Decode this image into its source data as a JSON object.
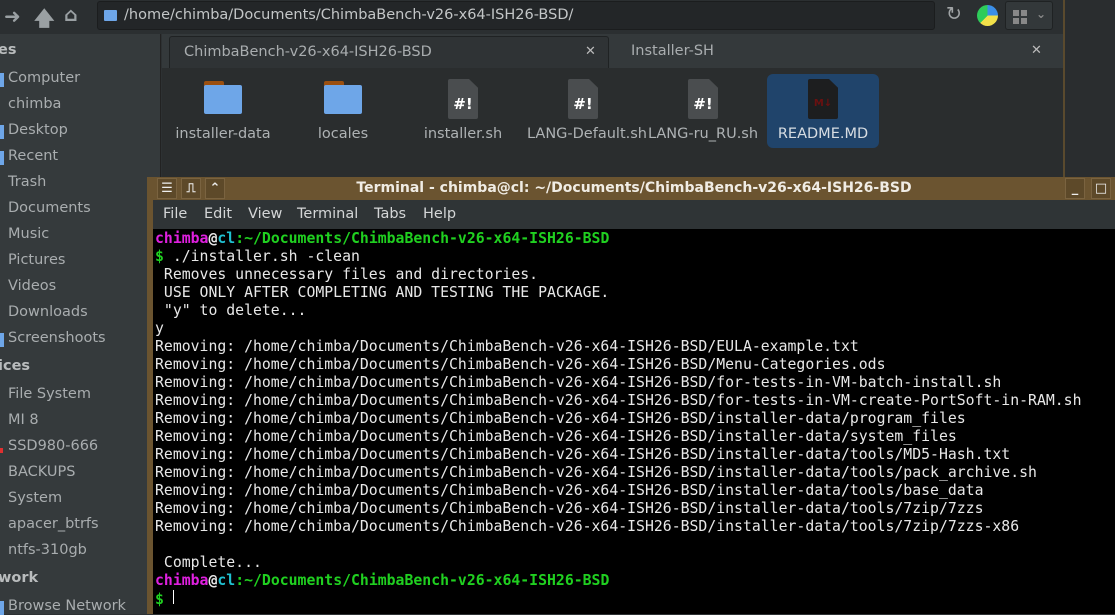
{
  "toolbar": {
    "path": "/home/chimba/Documents/ChimbaBench-v26-x64-ISH26-BSD/"
  },
  "sidebar": {
    "headers": [
      "es",
      "ices",
      "work"
    ],
    "places": [
      "Computer",
      "chimba",
      "Desktop",
      "Recent",
      "Trash",
      "Documents",
      "Music",
      "Pictures",
      "Videos",
      "Downloads",
      "Screenshoots"
    ],
    "devices": [
      "File System",
      "MI 8",
      "SSD980-666",
      "BACKUPS",
      "System",
      "apacer_btrfs",
      "ntfs-310gb"
    ],
    "network": [
      "Browse Network"
    ]
  },
  "tabs": [
    {
      "label": "ChimbaBench-v26-x64-ISH26-BSD"
    },
    {
      "label": "Installer-SH"
    }
  ],
  "files": [
    {
      "name": "installer-data",
      "type": "folder"
    },
    {
      "name": "locales",
      "type": "folder"
    },
    {
      "name": "installer.sh",
      "type": "script",
      "glyph": "#!"
    },
    {
      "name": "LANG-Default.sh",
      "type": "script",
      "glyph": "#!"
    },
    {
      "name": "LANG-ru_RU.sh",
      "type": "script",
      "glyph": "#!"
    },
    {
      "name": "README.MD",
      "type": "markdown",
      "glyph": "M↓"
    }
  ],
  "terminal": {
    "title": "Terminal - chimba@cl: ~/Documents/ChimbaBench-v26-x64-ISH26-BSD",
    "menu": [
      "File",
      "Edit",
      "View",
      "Terminal",
      "Tabs",
      "Help"
    ],
    "prompt": {
      "user": "chimba",
      "at": "@",
      "host": "cl",
      "path": ":~/Documents/ChimbaBench-v26-x64-ISH26-BSD",
      "symbol": "$"
    },
    "command": " ./installer.sh -clean",
    "lines": [
      " Removes unnecessary files and directories.",
      " USE ONLY AFTER COMPLETING AND TESTING THE PACKAGE.",
      " \"y\" to delete...",
      "y",
      "Removing: /home/chimba/Documents/ChimbaBench-v26-x64-ISH26-BSD/EULA-example.txt",
      "Removing: /home/chimba/Documents/ChimbaBench-v26-x64-ISH26-BSD/Menu-Categories.ods",
      "Removing: /home/chimba/Documents/ChimbaBench-v26-x64-ISH26-BSD/for-tests-in-VM-batch-install.sh",
      "Removing: /home/chimba/Documents/ChimbaBench-v26-x64-ISH26-BSD/for-tests-in-VM-create-PortSoft-in-RAM.sh",
      "Removing: /home/chimba/Documents/ChimbaBench-v26-x64-ISH26-BSD/installer-data/program_files",
      "Removing: /home/chimba/Documents/ChimbaBench-v26-x64-ISH26-BSD/installer-data/system_files",
      "Removing: /home/chimba/Documents/ChimbaBench-v26-x64-ISH26-BSD/installer-data/tools/MD5-Hash.txt",
      "Removing: /home/chimba/Documents/ChimbaBench-v26-x64-ISH26-BSD/installer-data/tools/pack_archive.sh",
      "Removing: /home/chimba/Documents/ChimbaBench-v26-x64-ISH26-BSD/installer-data/tools/base_data",
      "Removing: /home/chimba/Documents/ChimbaBench-v26-x64-ISH26-BSD/installer-data/tools/7zip/7zzs",
      "Removing: /home/chimba/Documents/ChimbaBench-v26-x64-ISH26-BSD/installer-data/tools/7zip/7zzs-x86",
      "",
      " Complete...",
      ""
    ]
  }
}
